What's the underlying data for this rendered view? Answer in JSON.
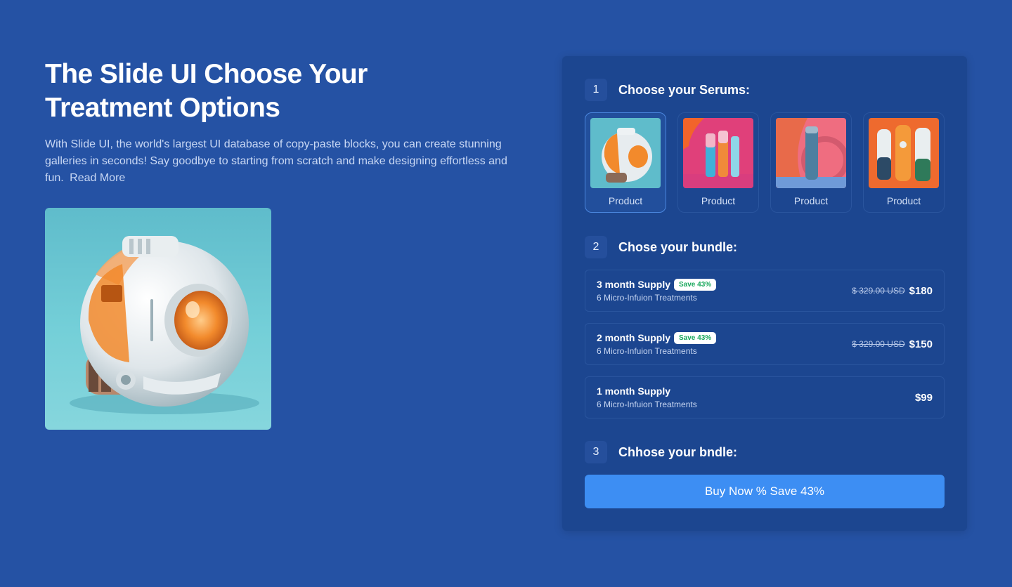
{
  "hero": {
    "title": "The Slide UI Choose Your Treatment Options",
    "description": "With Slide UI, the world's largest UI database of copy-paste blocks, you can create stunning galleries in seconds! Say goodbye to starting from scratch and make designing effortless and fun.",
    "read_more": "Read More"
  },
  "steps": {
    "serums": {
      "num": "1",
      "title": "Choose your Serums:"
    },
    "bundle": {
      "num": "2",
      "title": "Chose your bundle:"
    },
    "final": {
      "num": "3",
      "title": "Chhose your bndle:"
    }
  },
  "products": [
    {
      "label": "Product",
      "selected": true
    },
    {
      "label": "Product",
      "selected": false
    },
    {
      "label": "Product",
      "selected": false
    },
    {
      "label": "Product",
      "selected": false
    }
  ],
  "bundles": [
    {
      "name": "3 month Supply",
      "badge": "Save 43%",
      "sub": "6 Micro-Infuion Treatments",
      "old_price": "$ 329.00 USD",
      "price": "$180"
    },
    {
      "name": "2 month Supply",
      "badge": "Save 43%",
      "sub": "6 Micro-Infuion Treatments",
      "old_price": "$ 329.00 USD",
      "price": "$150"
    },
    {
      "name": "1 month Supply",
      "sub": "6 Micro-Infuion Treatments",
      "price": "$99"
    }
  ],
  "buy_button": "Buy Now % Save 43%",
  "colors": {
    "background": "#2552a4",
    "panel": "#1c4690",
    "accent": "#3d8ef3",
    "badge_text": "#1aa85c"
  }
}
